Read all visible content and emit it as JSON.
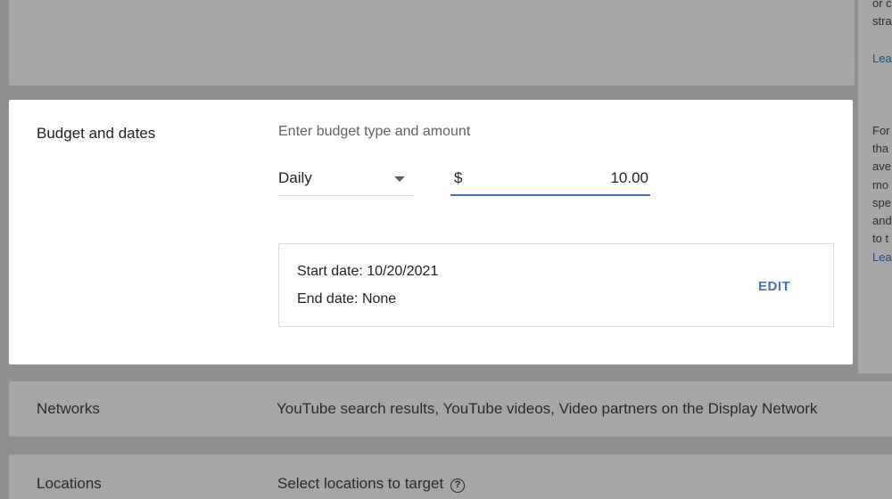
{
  "side_panel": {
    "top_lines": [
      "or c",
      "stra"
    ],
    "top_link": "Lea",
    "budget_lines": [
      "For",
      "tha",
      "ave",
      "mo",
      "spe",
      "and",
      "to t"
    ],
    "budget_link": "Lea"
  },
  "budget": {
    "title": "Budget and dates",
    "prompt": "Enter budget type and amount",
    "budget_type": "Daily",
    "currency_symbol": "$",
    "amount": "10.00",
    "start_date": "Start date: 10/20/2021",
    "end_date": "End date: None",
    "edit_label": "EDIT"
  },
  "networks": {
    "title": "Networks",
    "value": "YouTube search results, YouTube videos, Video partners on the Display Network"
  },
  "locations": {
    "title": "Locations",
    "value": "Select locations to target",
    "help_glyph": "?"
  },
  "colors": {
    "accent": "#4a6fbf",
    "overlay": "#8f8f8f"
  }
}
